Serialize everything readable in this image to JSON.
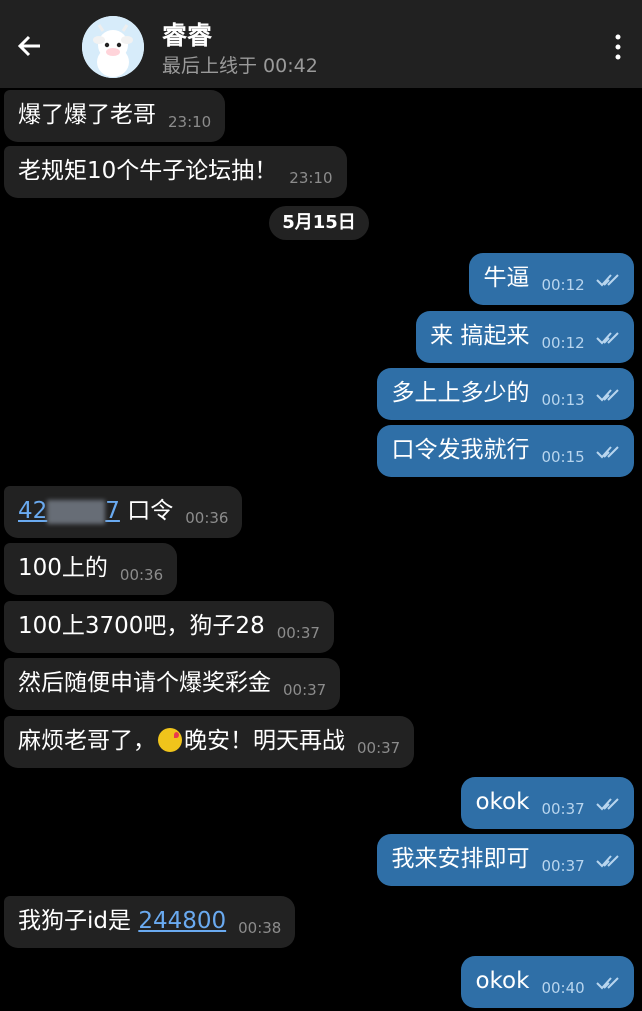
{
  "header": {
    "title": "睿睿",
    "subtitle": "最后上线于 00:42"
  },
  "date_separator": "5月15日",
  "messages": [
    {
      "text": "爆了爆了老哥",
      "time": "23:10"
    },
    {
      "text": "老规矩10个牛子论坛抽！",
      "time": "23:10"
    },
    {
      "text": "牛逼",
      "time": "00:12"
    },
    {
      "text": "来 搞起来",
      "time": "00:12"
    },
    {
      "text": "多上上多少的",
      "time": "00:13"
    },
    {
      "text": "口令发我就行",
      "time": "00:15"
    },
    {
      "link_prefix": "42",
      "link_suffix": "7",
      "text": "口令",
      "time": "00:36"
    },
    {
      "text": "100上的",
      "time": "00:36"
    },
    {
      "text": "100上3700吧，狗子28",
      "time": "00:37"
    },
    {
      "text": "然后随便申请个爆奖彩金",
      "time": "00:37"
    },
    {
      "text_before": "麻烦老哥了，",
      "text_after": "晚安！明天再战",
      "time": "00:37"
    },
    {
      "text": "okok",
      "time": "00:37"
    },
    {
      "text": "我来安排即可",
      "time": "00:37"
    },
    {
      "text": "我狗子id是",
      "link": "244800",
      "time": "00:38"
    },
    {
      "text": "okok",
      "time": "00:40"
    }
  ],
  "colors": {
    "header_bg": "#212121",
    "incoming_bubble": "#222222",
    "outgoing_bubble": "#2f6fa7",
    "link": "#6aaaf0"
  },
  "icons": [
    "back-arrow-icon",
    "more-vertical-icon",
    "double-check-icon",
    "kiss-emoji-icon"
  ]
}
